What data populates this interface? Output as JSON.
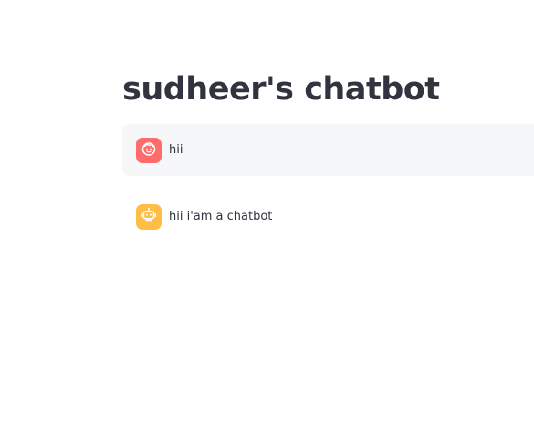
{
  "page": {
    "title": "sudheer's chatbot"
  },
  "messages": [
    {
      "role": "user",
      "avatar_icon": "face-icon",
      "avatar_color": "#ff6c6c",
      "text": "hii"
    },
    {
      "role": "assistant",
      "avatar_icon": "robot-icon",
      "avatar_color": "#ffbd45",
      "text": "hii i'am a chatbot"
    }
  ],
  "colors": {
    "text": "#31333f",
    "user_bubble_bg": "#f6f7f9",
    "background": "#ffffff"
  }
}
